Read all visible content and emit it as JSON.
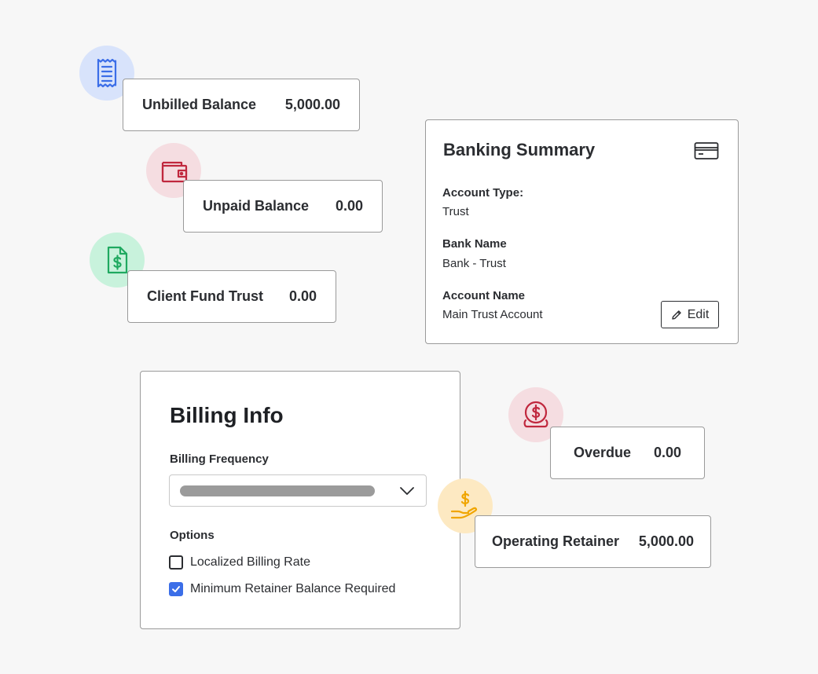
{
  "colors": {
    "background": "#f7f7f7",
    "blue_badge": "#d8e3fb",
    "red_badge": "#f5dde1",
    "green_badge": "#c8f2dc",
    "yellow_badge": "#fde9c2",
    "checkbox_accent": "#3b6ee8"
  },
  "metrics": [
    {
      "label": "Unbilled Balance",
      "value": "5,000.00",
      "icon": "receipt-icon"
    },
    {
      "label": "Unpaid Balance",
      "value": "0.00",
      "icon": "wallet-icon"
    },
    {
      "label": "Client Fund Trust",
      "value": "0.00",
      "icon": "dollar-document-icon"
    },
    {
      "label": "Overdue",
      "value": "0.00",
      "icon": "dollar-coin-icon"
    },
    {
      "label": "Operating Retainer",
      "value": "5,000.00",
      "icon": "dollar-hand-icon"
    }
  ],
  "banking": {
    "title": "Banking Summary",
    "icon": "credit-card-icon",
    "account_type_label": "Account Type:",
    "account_type_value": "Trust",
    "bank_name_label": "Bank Name",
    "bank_name_value": "Bank - Trust",
    "account_name_label": "Account Name",
    "account_name_value": "Main Trust Account",
    "edit_label": "Edit"
  },
  "billing": {
    "title": "Billing Info",
    "frequency_label": "Billing Frequency",
    "options_label": "Options",
    "options": [
      {
        "label": "Localized Billing Rate",
        "checked": false
      },
      {
        "label": "Minimum Retainer Balance Required",
        "checked": true
      }
    ]
  }
}
